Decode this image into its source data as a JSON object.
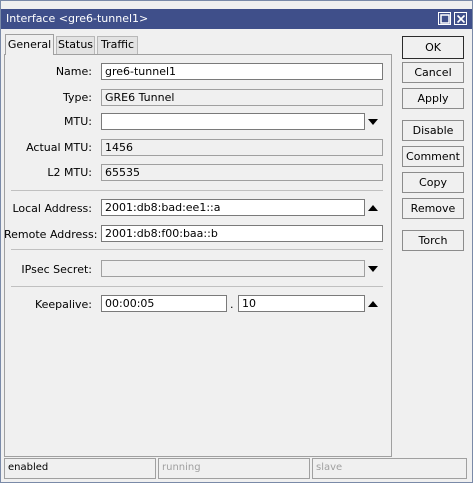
{
  "window": {
    "title": "Interface <gre6-tunnel1>"
  },
  "tabs": [
    {
      "label": "General"
    },
    {
      "label": "Status"
    },
    {
      "label": "Traffic"
    }
  ],
  "form": {
    "name": {
      "label": "Name:",
      "value": "gre6-tunnel1"
    },
    "type": {
      "label": "Type:",
      "value": "GRE6 Tunnel"
    },
    "mtu": {
      "label": "MTU:",
      "value": ""
    },
    "actual_mtu": {
      "label": "Actual MTU:",
      "value": "1456"
    },
    "l2_mtu": {
      "label": "L2 MTU:",
      "value": "65535"
    },
    "local_address": {
      "label": "Local Address:",
      "value": "2001:db8:bad:ee1::a"
    },
    "remote_address": {
      "label": "Remote Address:",
      "value": "2001:db8:f00:baa::b"
    },
    "ipsec_secret": {
      "label": "IPsec Secret:",
      "value": ""
    },
    "keepalive": {
      "label": "Keepalive:",
      "interval": "00:00:05",
      "separator": ".",
      "retries": "10"
    }
  },
  "buttons": {
    "ok": "OK",
    "cancel": "Cancel",
    "apply": "Apply",
    "disable": "Disable",
    "comment": "Comment",
    "copy": "Copy",
    "remove": "Remove",
    "torch": "Torch"
  },
  "statusbar": {
    "state": "enabled",
    "running": "running",
    "slave": "slave"
  },
  "icons": {
    "restore": "restore-icon",
    "close": "close-icon",
    "dropdown": "dropdown-arrow-icon",
    "collapse": "collapse-arrow-icon"
  },
  "colors": {
    "titlebar": "#3f4f8a",
    "window_bg": "#f0f0f0",
    "field_bg": "#ffffff",
    "disabled_text": "#a0a0a0"
  }
}
